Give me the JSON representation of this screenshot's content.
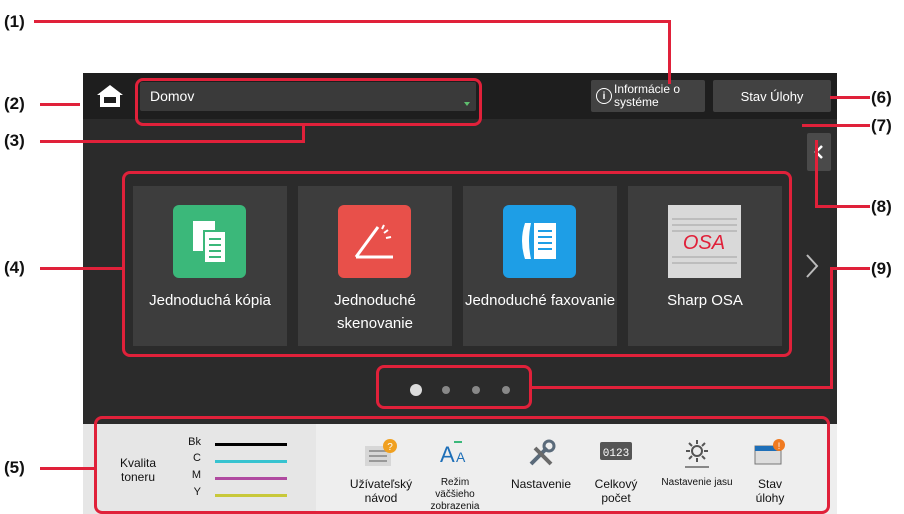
{
  "topbar": {
    "location": "Domov",
    "info_button": "Informácie o systéme",
    "job_status_button": "Stav Úlohy"
  },
  "tiles": [
    {
      "label": "Jednoduchá kópia",
      "icon": "copy-icon",
      "color": "#3bb87a"
    },
    {
      "label": "Jednoduché skenovanie",
      "icon": "scan-icon",
      "color": "#e8504a"
    },
    {
      "label": "Jednoduché faxovanie",
      "icon": "fax-icon",
      "color": "#1e9ee6"
    },
    {
      "label": "Sharp OSA",
      "icon": "osa-logo-icon",
      "color": "#d9d9d9"
    }
  ],
  "page_indicator": {
    "pages": 4,
    "current": 1
  },
  "toner": {
    "title": "Kvalita toneru",
    "channels": [
      {
        "name": "Bk",
        "color": "#000000"
      },
      {
        "name": "C",
        "color": "#37c3d0"
      },
      {
        "name": "M",
        "color": "#b04aa0"
      },
      {
        "name": "Y",
        "color": "#c8c83a"
      }
    ]
  },
  "bottom_items": [
    {
      "label": "Užívateľský návod",
      "icon": "manual-icon"
    },
    {
      "label": "Režim väčšieho zobrazenia",
      "icon": "large-text-icon"
    },
    {
      "label": "Nastavenie",
      "icon": "settings-tools-icon"
    },
    {
      "label": "Celkový počet",
      "icon": "counter-icon"
    },
    {
      "label": "Nastavenie jasu",
      "icon": "brightness-icon"
    },
    {
      "label": "Stav úlohy",
      "icon": "job-status-icon"
    }
  ],
  "callouts": [
    "(1)",
    "(2)",
    "(3)",
    "(4)",
    "(5)",
    "(6)",
    "(7)",
    "(8)",
    "(9)"
  ],
  "accent_color": "#e0213a"
}
